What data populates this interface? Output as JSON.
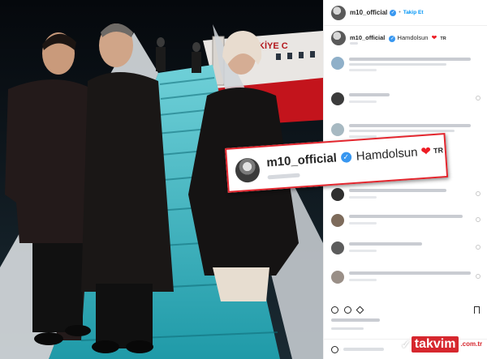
{
  "post": {
    "username": "m10_official",
    "follow_label": "Takip Et",
    "separator": "•",
    "caption_text": "Hamdolsun",
    "caption_flag": "TR",
    "heart": "❤",
    "verified_glyph": "✓"
  },
  "plane": {
    "livery_text": "KİYE C"
  },
  "callout": {
    "username": "m10_official",
    "text": "Hamdolsun",
    "flag": "TR",
    "heart": "❤",
    "verified_glyph": "✓",
    "border_color": "#e3262e"
  },
  "watermark": {
    "brand": "takvim",
    "tld": ".com.tr",
    "color": "#d6272e"
  },
  "icons": [
    "verified-icon",
    "heart-icon",
    "comment-icon",
    "share-icon",
    "bookmark-icon",
    "smiley-icon"
  ]
}
